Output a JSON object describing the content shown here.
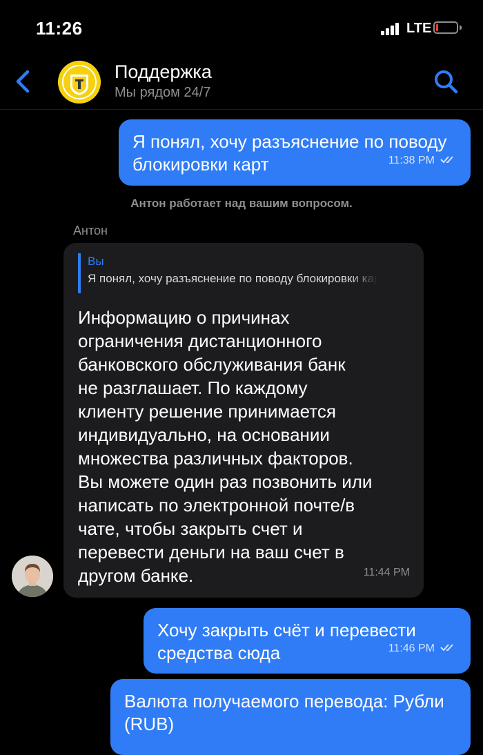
{
  "status_bar": {
    "time": "11:26",
    "network": "LTE",
    "battery_level": 0.1,
    "battery_color": "#ff3b30"
  },
  "header": {
    "title": "Поддержка",
    "subtitle": "Мы рядом 24/7",
    "back_icon": "chevron-left-icon",
    "search_icon": "search-icon",
    "accent_color": "#2f7cf6"
  },
  "messages": [
    {
      "direction": "outgoing",
      "text": "Я понял, хочу разъяснение по поводу блокировки карт",
      "time": "11:38 PM",
      "status": "read"
    },
    {
      "direction": "system",
      "text": "Антон работает над вашим вопросом."
    },
    {
      "direction": "incoming",
      "sender": "Антон",
      "reply_to": {
        "author": "Вы",
        "text": "Я понял, хочу разъяснение по поводу блокировки карт"
      },
      "text": "Информацию о причинах\nограничения дистанционного\nбанковского обслуживания банк\nне разглашает. По каждому\nклиенту решение принимается\nиндивидуально, на основании\nмножества различных факторов.\nВы можете один раз позвонить или\nнаписать по электронной почте/в\nчате, чтобы закрыть счет и\nперевести деньги на ваш счет в\nдругом банке.",
      "time": "11:44 PM"
    },
    {
      "direction": "outgoing",
      "text": "Хочу закрыть счёт и перевести средства сюда",
      "time": "11:46 PM",
      "status": "read"
    },
    {
      "direction": "outgoing",
      "text": "Валюта получаемого перевода: Рубли (RUB)"
    }
  ],
  "colors": {
    "outgoing_bubble": "#2f7cf6",
    "incoming_bubble": "#1c1c1e",
    "background": "#000000"
  }
}
